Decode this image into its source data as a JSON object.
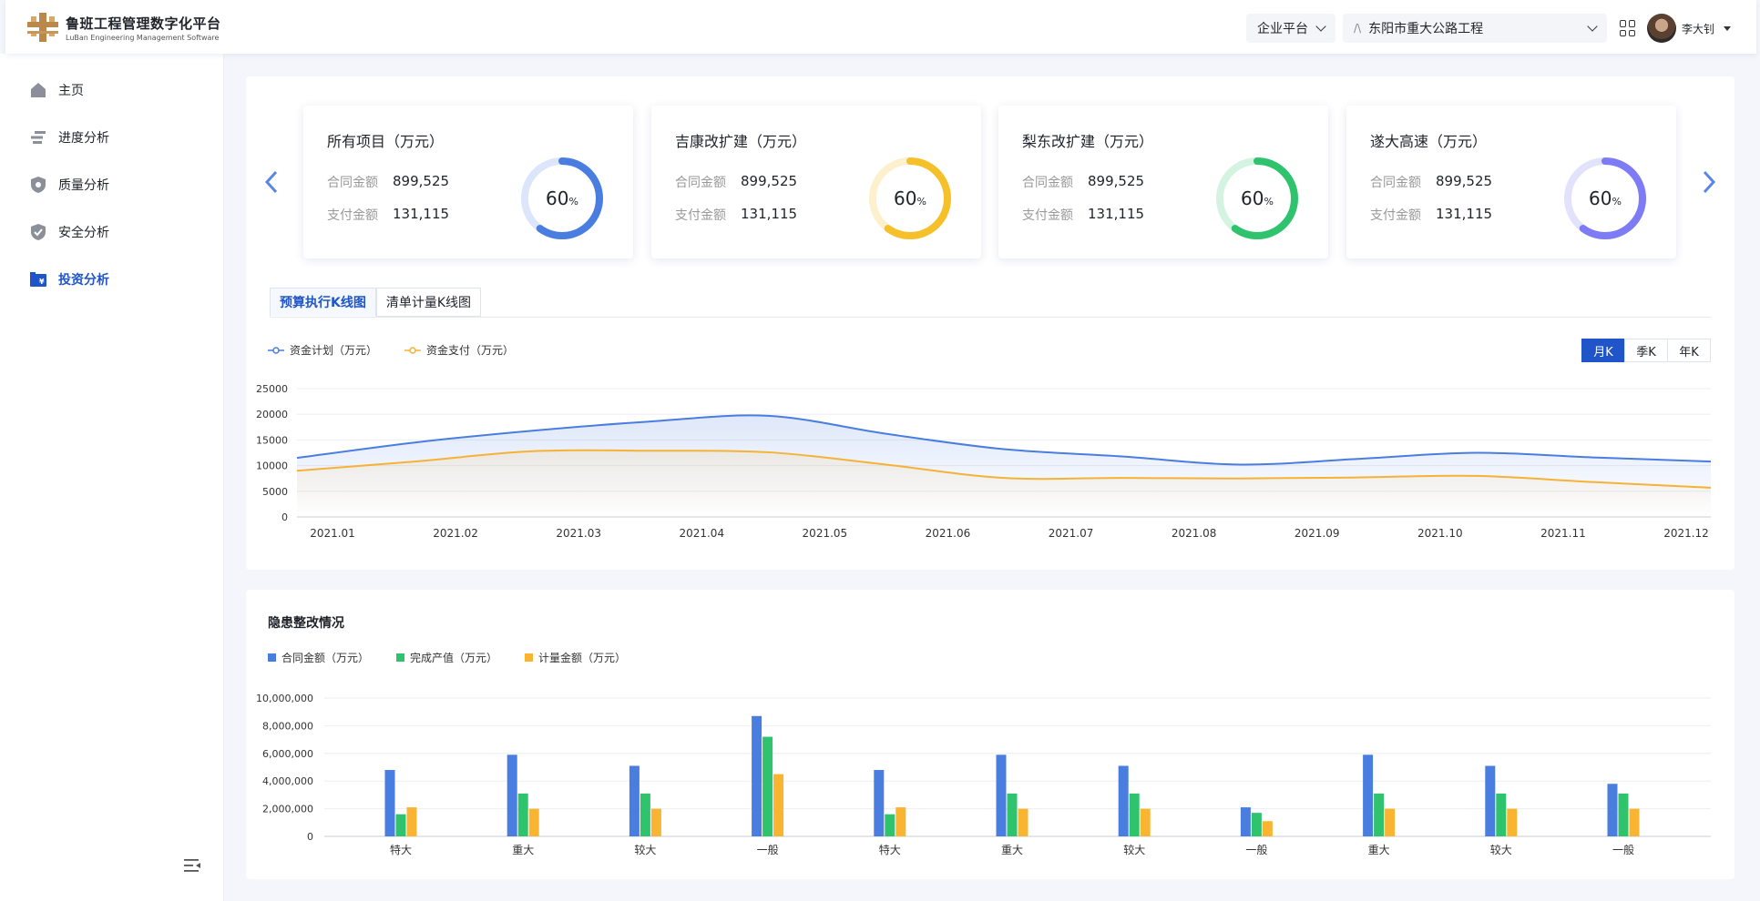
{
  "header": {
    "logo_cn": "鲁班工程管理数字化平台",
    "logo_en": "LuBan Engineering Management Software",
    "platform_select": "企业平台",
    "project_lead": "/\\",
    "project_select": "东阳市重大公路工程",
    "user_name": "李大钊"
  },
  "sidebar": {
    "items": [
      {
        "label": "主页",
        "icon": "home-icon"
      },
      {
        "label": "进度分析",
        "icon": "progress-icon"
      },
      {
        "label": "质量分析",
        "icon": "quality-shield-icon"
      },
      {
        "label": "安全分析",
        "icon": "safety-shield-icon"
      },
      {
        "label": "投资分析",
        "icon": "investment-icon",
        "active": true
      }
    ]
  },
  "kpis": [
    {
      "title": "所有项目（万元）",
      "contract_label": "合同金额",
      "contract_value": "899,525",
      "paid_label": "支付金额",
      "paid_value": "131,115",
      "percent": "60",
      "percent_unit": "%",
      "ratio": 0.6,
      "color": "#4a7de0",
      "track": "#dce6fb"
    },
    {
      "title": "吉康改扩建（万元）",
      "contract_label": "合同金额",
      "contract_value": "899,525",
      "paid_label": "支付金额",
      "paid_value": "131,115",
      "percent": "60",
      "percent_unit": "%",
      "ratio": 0.6,
      "color": "#f5c02a",
      "track": "#fdf0cc"
    },
    {
      "title": "梨东改扩建（万元）",
      "contract_label": "合同金额",
      "contract_value": "899,525",
      "paid_label": "支付金额",
      "paid_value": "131,115",
      "percent": "60",
      "percent_unit": "%",
      "ratio": 0.6,
      "color": "#2fc36e",
      "track": "#d4f3e1"
    },
    {
      "title": "遂大高速（万元）",
      "contract_label": "合同金额",
      "contract_value": "899,525",
      "paid_label": "支付金额",
      "paid_value": "131,115",
      "percent": "60",
      "percent_unit": "%",
      "ratio": 0.6,
      "color": "#7d7bf5",
      "track": "#e3e2fd"
    }
  ],
  "kline": {
    "tabs": [
      "预算执行K线图",
      "清单计量K线图"
    ],
    "period_buttons": [
      "月K",
      "季K",
      "年K"
    ],
    "active_period": "月K"
  },
  "hazard": {
    "title": "隐患整改情况"
  },
  "colors": {
    "primary": "#1f55c8",
    "plan_line": "#4a7de0",
    "pay_line": "#f5b236",
    "bar_contract": "#4a7de0",
    "bar_output": "#2fc36e",
    "bar_measure": "#f9b531"
  },
  "chart_data": [
    {
      "type": "line",
      "series": [
        {
          "name": "资金计划（万元）",
          "values": [
            11500,
            14500,
            16800,
            18600,
            19700,
            16200,
            13200,
            11800,
            10200,
            11300,
            12500,
            11600,
            10800
          ]
        },
        {
          "name": "资金支付（万元）",
          "values": [
            9000,
            10800,
            12800,
            12900,
            12600,
            10200,
            7600,
            7600,
            7500,
            7700,
            8000,
            6800,
            5700
          ]
        }
      ],
      "x_labels": [
        "2021.01",
        "2021.02",
        "2021.03",
        "2021.04",
        "2021.05",
        "2021.06",
        "2021.07",
        "2021.08",
        "2021.09",
        "2021.10",
        "2021.11",
        "2021.12"
      ],
      "y_ticks": [
        "25000",
        "20000",
        "15000",
        "10000",
        "5000",
        "0"
      ],
      "ylim": [
        0,
        25000
      ],
      "grid": true,
      "legend": "top-left"
    },
    {
      "type": "bar",
      "categories": [
        "特大",
        "重大",
        "较大",
        "一般",
        "特大",
        "重大",
        "较大",
        "一般",
        "重大",
        "较大",
        "一般"
      ],
      "series": [
        {
          "name": "合同金额（万元）",
          "values": [
            4800000,
            5900000,
            5100000,
            8700000,
            4800000,
            5900000,
            5100000,
            2100000,
            5900000,
            5100000,
            3800000
          ]
        },
        {
          "name": "完成产值（万元）",
          "values": [
            1600000,
            3100000,
            3100000,
            7200000,
            1600000,
            3100000,
            3100000,
            1700000,
            3100000,
            3100000,
            3100000
          ]
        },
        {
          "name": "计量金额（万元）",
          "values": [
            2100000,
            2000000,
            2000000,
            4500000,
            2100000,
            2000000,
            2000000,
            1100000,
            2000000,
            2000000,
            2000000
          ]
        }
      ],
      "y_ticks": [
        "10,000,000",
        "8,000,000",
        "6,000,000",
        "4,000,000",
        "2,000,000",
        "0"
      ],
      "ylim": [
        0,
        10000000
      ],
      "grid": true,
      "legend": "top-left"
    }
  ]
}
